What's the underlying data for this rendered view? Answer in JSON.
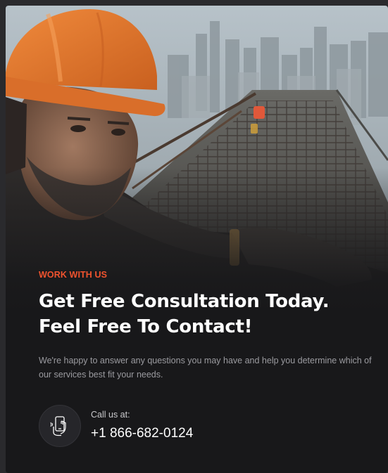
{
  "section": {
    "eyebrow": "WORK WITH US",
    "headline_line1": "Get Free Consultation Today.",
    "headline_line2": "Feel Free To Contact!",
    "description": "We're happy to answer any questions you may have and help you determine which of our services best fit your needs."
  },
  "contact": {
    "label": "Call us at:",
    "phone": "+1 866-682-0124",
    "icon": "phone-in-hand-icon"
  },
  "colors": {
    "accent": "#f0532e",
    "background": "#18181a",
    "heading": "#ffffff",
    "muted_text": "#9b9ba0",
    "helmet": "#e8772e"
  }
}
